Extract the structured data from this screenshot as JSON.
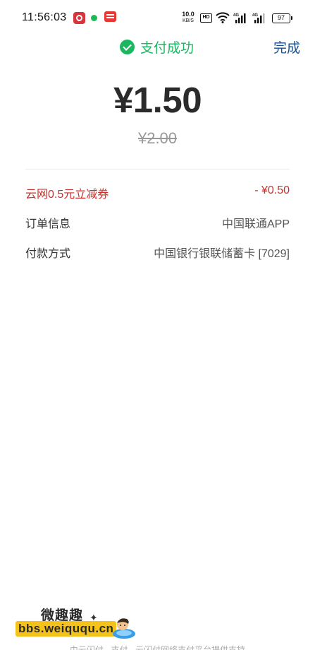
{
  "status_bar": {
    "time": "11:56:03",
    "net_speed": "10.0",
    "net_unit": "KB/S",
    "hd": "HD",
    "battery": "97"
  },
  "header": {
    "title": "支付成功",
    "done_label": "完成"
  },
  "payment": {
    "amount": "¥1.50",
    "original_amount": "¥2.00"
  },
  "details": [
    {
      "label": "云网0.5元立减券",
      "value": "- ¥0.50"
    },
    {
      "label": "订单信息",
      "value": "中国联通APP"
    },
    {
      "label": "付款方式",
      "value": "中国银行银联储蓄卡 [7029]"
    }
  ],
  "watermark": {
    "title": "微趣趣",
    "url": "bbs.weiququ.cn"
  },
  "footer": {
    "text": "由云闪付 · 支付 · 云闪付网络支付平台提供支持"
  },
  "colors": {
    "success": "#1bb660",
    "link": "#1b4f8c",
    "discount": "#c9302c"
  }
}
